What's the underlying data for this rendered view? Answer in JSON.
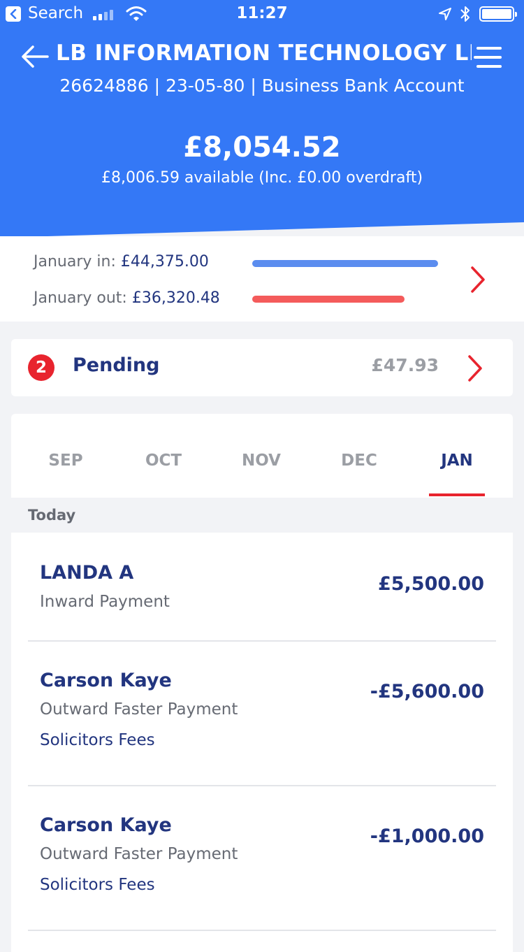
{
  "status_bar": {
    "back_app": "Search",
    "time": "11:27"
  },
  "header": {
    "account_name": "LB INFORMATION TECHNOLOGY LIM...",
    "account_details": "26624886 | 23-05-80 | Business Bank Account",
    "balance": "£8,054.52",
    "available": "£8,006.59 available (Inc. £0.00 overdraft)"
  },
  "summary": {
    "in_label": "January in: ",
    "in_amount": "£44,375.00",
    "out_label": "January out: ",
    "out_amount": "£36,320.48",
    "in_bar_fraction": 1.0,
    "out_bar_fraction": 0.82
  },
  "pending": {
    "count": "2",
    "label": "Pending",
    "amount": "£47.93"
  },
  "months": {
    "tabs": [
      "SEP",
      "OCT",
      "NOV",
      "DEC",
      "JAN"
    ],
    "active": "JAN"
  },
  "transactions": {
    "day_label": "Today",
    "items": [
      {
        "name": "LANDA A",
        "type": "Inward Payment",
        "reference": "",
        "amount": "£5,500.00"
      },
      {
        "name": "Carson Kaye",
        "type": "Outward Faster Payment",
        "reference": "Solicitors Fees",
        "amount": "-£5,600.00"
      },
      {
        "name": "Carson Kaye",
        "type": "Outward Faster Payment",
        "reference": "Solicitors Fees",
        "amount": "-£1,000.00"
      }
    ]
  },
  "colors": {
    "header_blue": "#3478f6",
    "text_navy": "#22357f",
    "in_bar": "#5b8def",
    "out_bar": "#f45b5b",
    "accent_red": "#e8242e"
  },
  "icons": [
    "back-app-icon",
    "signal-icon",
    "wifi-icon",
    "location-icon",
    "bluetooth-icon",
    "battery-icon",
    "back-arrow-icon",
    "menu-icon",
    "chevron-right-icon"
  ]
}
